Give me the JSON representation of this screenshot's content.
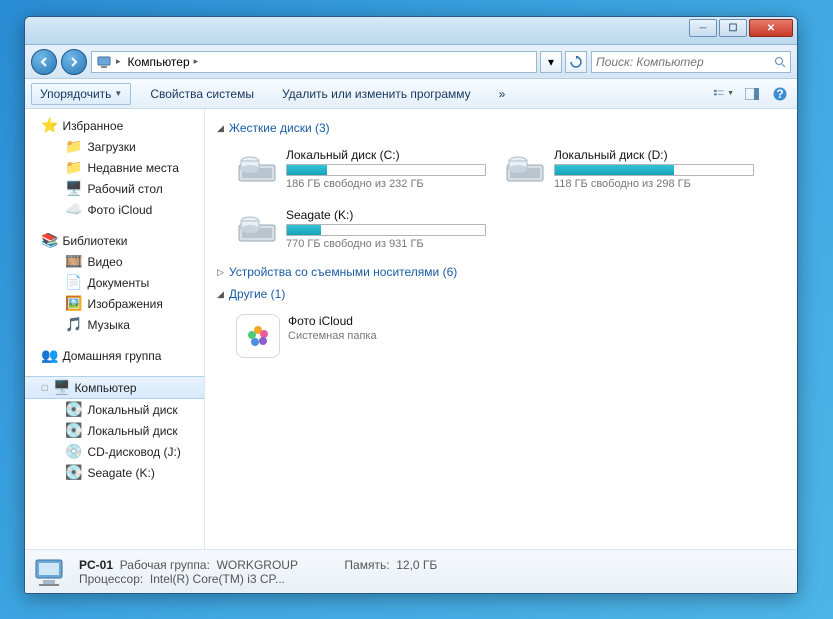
{
  "breadcrumb": {
    "root": "Компьютер"
  },
  "search": {
    "placeholder": "Поиск: Компьютер"
  },
  "toolbar": {
    "organize": "Упорядочить",
    "properties": "Свойства системы",
    "uninstall": "Удалить или изменить программу",
    "more": "»"
  },
  "sidebar": {
    "favorites": {
      "label": "Избранное",
      "items": [
        "Загрузки",
        "Недавние места",
        "Рабочий стол",
        "Фото iCloud"
      ]
    },
    "libraries": {
      "label": "Библиотеки",
      "items": [
        "Видео",
        "Документы",
        "Изображения",
        "Музыка"
      ]
    },
    "homegroup": {
      "label": "Домашняя группа"
    },
    "computer": {
      "label": "Компьютер",
      "items": [
        "Локальный диск",
        "Локальный диск",
        "CD-дисковод (J:)",
        "Seagate (K:)"
      ]
    }
  },
  "groups": {
    "hdd": {
      "label": "Жесткие диски (3)"
    },
    "removable": {
      "label": "Устройства со съемными носителями (6)"
    },
    "other": {
      "label": "Другие (1)"
    }
  },
  "drives": [
    {
      "name": "Локальный диск (C:)",
      "freetext": "186 ГБ свободно из 232 ГБ",
      "fill_pct": 20
    },
    {
      "name": "Локальный диск (D:)",
      "freetext": "118 ГБ свободно из 298 ГБ",
      "fill_pct": 60
    },
    {
      "name": "Seagate (K:)",
      "freetext": "770 ГБ свободно из 931 ГБ",
      "fill_pct": 17
    }
  ],
  "other_items": [
    {
      "name": "Фото iCloud",
      "sub": "Системная папка"
    }
  ],
  "status": {
    "pcname": "PC-01",
    "workgroup_lbl": "Рабочая группа:",
    "workgroup": "WORKGROUP",
    "memory_lbl": "Память:",
    "memory": "12,0 ГБ",
    "cpu_lbl": "Процессор:",
    "cpu": "Intel(R) Core(TM) i3 CP..."
  }
}
